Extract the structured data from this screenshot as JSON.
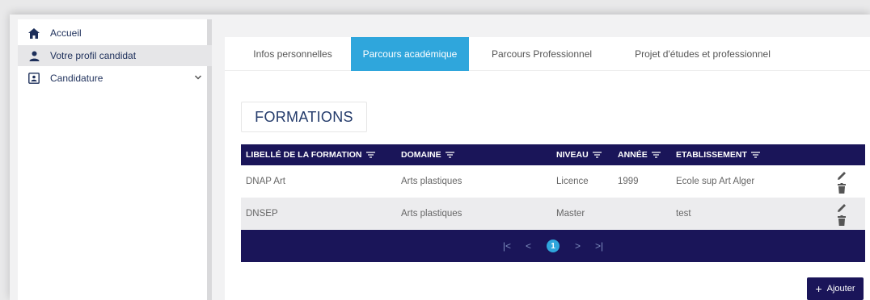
{
  "sidebar": {
    "items": [
      {
        "label": "Accueil",
        "icon": "home-icon"
      },
      {
        "label": "Votre profil candidat",
        "icon": "user-icon",
        "active": true
      },
      {
        "label": "Candidature",
        "icon": "application-icon",
        "expandable": true
      }
    ]
  },
  "tabs": [
    {
      "label": "Infos personnelles"
    },
    {
      "label": "Parcours académique",
      "active": true
    },
    {
      "label": "Parcours Professionnel"
    },
    {
      "label": "Projet d'études et professionnel"
    }
  ],
  "section": {
    "title": "FORMATIONS"
  },
  "table": {
    "columns": [
      "LIBELLÉ DE LA FORMATION",
      "DOMAINE",
      "NIVEAU",
      "ANNÉE",
      "ETABLISSEMENT"
    ],
    "rows": [
      {
        "libelle": "DNAP Art",
        "domaine": "Arts plastiques",
        "niveau": "Licence",
        "annee": "1999",
        "etablissement": "Ecole sup Art Alger"
      },
      {
        "libelle": "DNSEP",
        "domaine": "Arts plastiques",
        "niveau": "Master",
        "annee": "",
        "etablissement": "test"
      }
    ]
  },
  "pagination": {
    "first": "|<",
    "prev": "<",
    "current": "1",
    "next": ">",
    "last": ">|"
  },
  "actions": {
    "add_label": "Ajouter",
    "add_icon": "+"
  },
  "colors": {
    "navy": "#1a1559",
    "accent": "#2fa6dc",
    "nav_text": "#1d2f5a"
  }
}
